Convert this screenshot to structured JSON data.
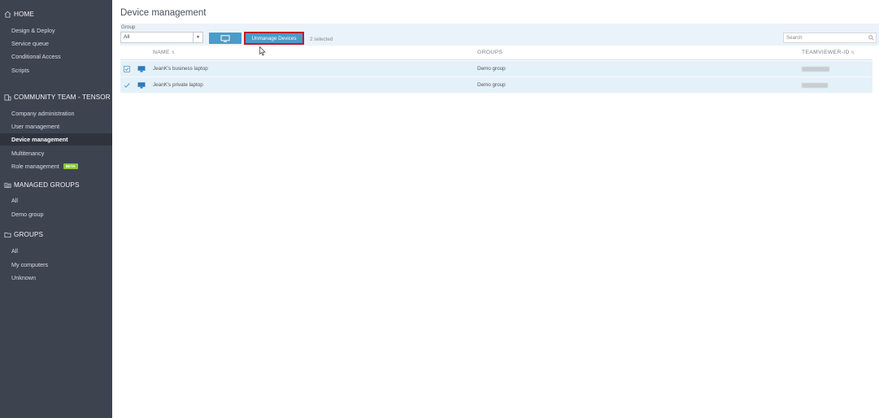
{
  "sidebar": {
    "home": {
      "label": "HOME",
      "items": [
        {
          "label": "Design & Deploy"
        },
        {
          "label": "Service queue"
        },
        {
          "label": "Conditional Access"
        },
        {
          "label": "Scripts"
        }
      ]
    },
    "community": {
      "label": "COMMUNITY TEAM - TENSOR",
      "items": [
        {
          "label": "Company administration"
        },
        {
          "label": "User management"
        },
        {
          "label": "Device management",
          "active": true
        },
        {
          "label": "Multitenancy"
        },
        {
          "label": "Role management",
          "badge": "BETA"
        }
      ]
    },
    "managed_groups": {
      "label": "MANAGED GROUPS",
      "items": [
        {
          "label": "All"
        },
        {
          "label": "Demo group"
        }
      ]
    },
    "groups": {
      "label": "GROUPS",
      "items": [
        {
          "label": "All"
        },
        {
          "label": "My computers"
        },
        {
          "label": "Unknown"
        }
      ]
    }
  },
  "main": {
    "title": "Device management",
    "toolbar": {
      "group_label": "Group",
      "group_value": "All",
      "unmanage_label": "Unmanage Devices",
      "selected_text": "2 selected",
      "search_placeholder": "Search"
    },
    "table": {
      "columns": {
        "name": "NAME",
        "groups": "GROUPS",
        "teamviewer_id": "TEAMVIEWER-ID"
      },
      "rows": [
        {
          "name": "JeanK's business laptop",
          "group": "Demo group"
        },
        {
          "name": "JeanK's private laptop",
          "group": "Demo group"
        }
      ]
    }
  },
  "colors": {
    "sidebar_bg": "#3e4350",
    "accent": "#4a9cc9",
    "highlight_border": "#c41a24",
    "selected_row": "#e4f1f9"
  }
}
